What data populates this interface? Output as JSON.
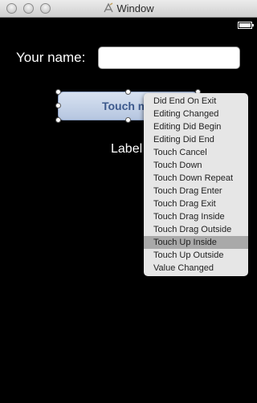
{
  "window": {
    "title": "Window"
  },
  "status_bar": {
    "battery": "battery-icon"
  },
  "form": {
    "name_label": "Your name:",
    "name_value": "",
    "button_label": "Touch me",
    "result_label": "Label"
  },
  "event_menu": {
    "items": [
      "Did End On Exit",
      "Editing Changed",
      "Editing Did Begin",
      "Editing Did End",
      "Touch Cancel",
      "Touch Down",
      "Touch Down Repeat",
      "Touch Drag Enter",
      "Touch Drag Exit",
      "Touch Drag Inside",
      "Touch Drag Outside",
      "Touch Up Inside",
      "Touch Up Outside",
      "Value Changed"
    ],
    "selected": "Touch Up Inside"
  },
  "colors": {
    "background": "#000000",
    "button_text": "#3d5a8d",
    "menu_bg": "#e6e6e6",
    "menu_highlight": "#a9a9a9"
  }
}
